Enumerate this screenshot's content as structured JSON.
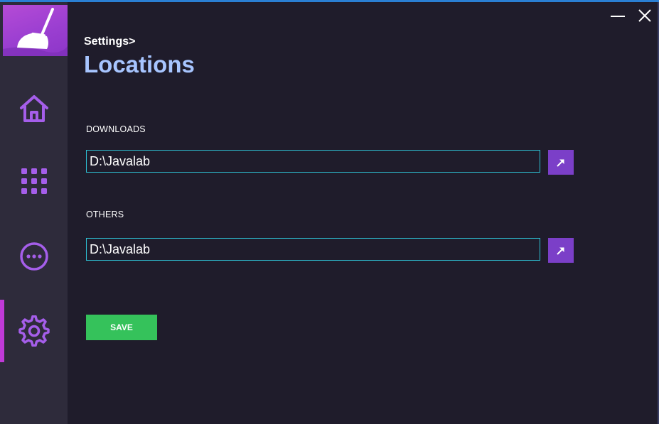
{
  "app": {
    "icon": "broom-icon",
    "accent_color": "#9b3fd1"
  },
  "window_controls": {
    "minimize_icon": "minimize-icon",
    "close_icon": "close-icon"
  },
  "sidebar": {
    "items": [
      {
        "id": "home",
        "icon": "home-icon",
        "active": false
      },
      {
        "id": "apps",
        "icon": "grid-icon",
        "active": false
      },
      {
        "id": "more",
        "icon": "more-icon",
        "active": false
      },
      {
        "id": "settings",
        "icon": "gear-icon",
        "active": true
      }
    ]
  },
  "header": {
    "breadcrumb": "Settings>",
    "title": "Locations"
  },
  "locations": {
    "downloads": {
      "label": "DOWNLOADS",
      "value": "D:\\Javalab",
      "browse_icon": "arrow-up-right-icon"
    },
    "others": {
      "label": "OTHERS",
      "value": "D:\\Javalab",
      "browse_icon": "arrow-up-right-icon"
    }
  },
  "actions": {
    "save_label": "SAVE"
  },
  "colors": {
    "background": "#1f1c2b",
    "sidebar": "#2e2b3b",
    "icon_purple": "#a55eea",
    "title_blue": "#a7c5ff",
    "input_border": "#2ec3d6",
    "browse_button": "#7b3fc8",
    "save_button": "#35c25b",
    "active_indicator": "#c03ad8"
  }
}
